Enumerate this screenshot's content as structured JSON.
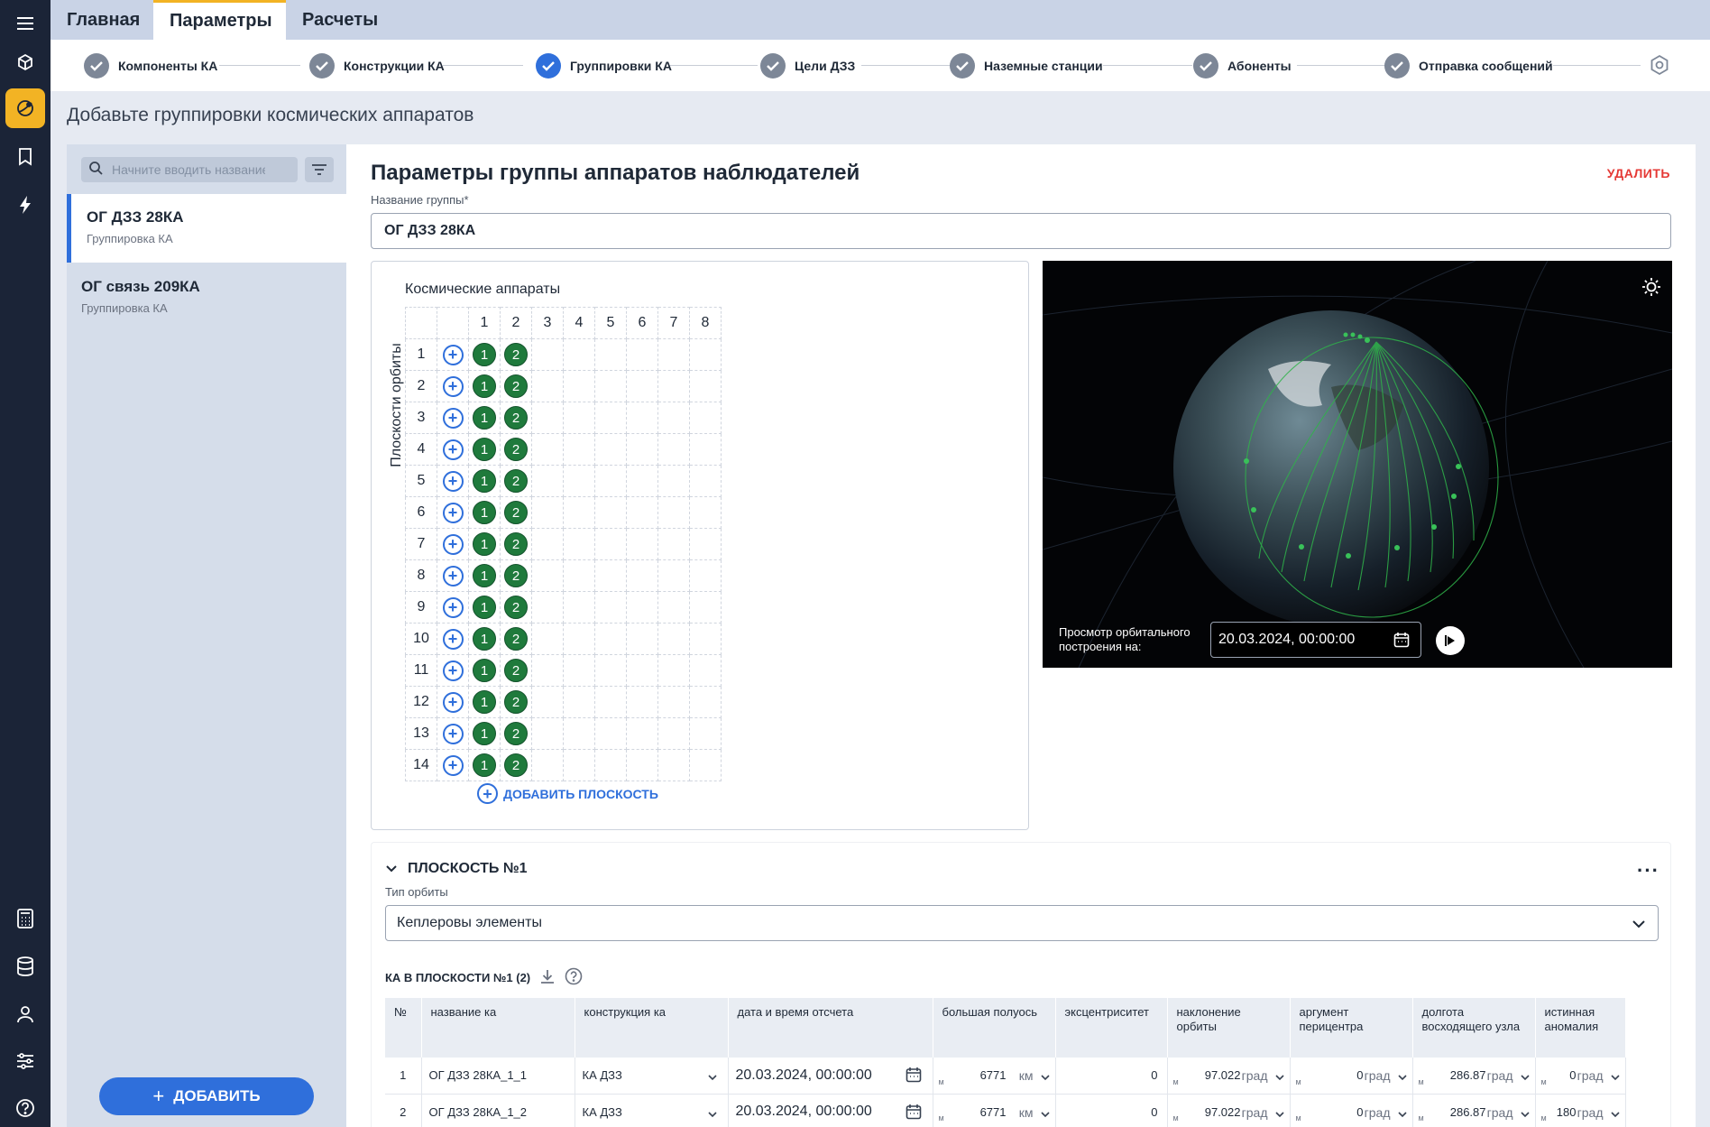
{
  "top_tabs": [
    {
      "label": "Главная"
    },
    {
      "label": "Параметры"
    },
    {
      "label": "Расчеты"
    }
  ],
  "steps": [
    {
      "label": "Компоненты КА"
    },
    {
      "label": "Конструкции КА"
    },
    {
      "label": "Группировки КА"
    },
    {
      "label": "Цели ДЗЗ"
    },
    {
      "label": "Наземные станции"
    },
    {
      "label": "Абоненты"
    },
    {
      "label": "Отправка сообщений"
    }
  ],
  "page_title": "Добавьте группировки космических аппаратов",
  "search": {
    "placeholder": "Начните вводить название"
  },
  "groups": [
    {
      "title": "ОГ ДЗЗ 28КА",
      "subtitle": "Группировка КА"
    },
    {
      "title": "ОГ связь 209КА",
      "subtitle": "Группировка КА"
    }
  ],
  "add_button": "ДОБАВИТЬ",
  "main": {
    "title": "Параметры группы аппаратов наблюдателей",
    "delete_label": "УДАЛИТЬ",
    "group_name_label": "Название группы*",
    "group_name_value": "ОГ ДЗЗ 28КА"
  },
  "grid": {
    "title": "Космические аппараты",
    "vertical_label": "Плоскости орбиты",
    "columns": [
      "1",
      "2",
      "3",
      "4",
      "5",
      "6",
      "7",
      "8"
    ],
    "rows": [
      "1",
      "2",
      "3",
      "4",
      "5",
      "6",
      "7",
      "8",
      "9",
      "10",
      "11",
      "12",
      "13",
      "14"
    ],
    "sat_labels": [
      "1",
      "2"
    ],
    "add_plane": "ДОБАВИТЬ ПЛОСКОСТЬ"
  },
  "globe": {
    "view_label_1": "Просмотр орбитального",
    "view_label_2": "построения на:",
    "date": "20.03.2024, 00:00:00"
  },
  "plane": {
    "title": "ПЛОСКОСТЬ №1",
    "orbit_type_label": "Тип орбиты",
    "orbit_type_value": "Кеплеровы элементы",
    "ka_header": "КА В ПЛОСКОСТИ №1 (2)"
  },
  "table": {
    "headers": [
      "№",
      "название ка",
      "конструкция ка",
      "дата и время отсчета",
      "большая полуось",
      "эксцентриситет",
      "наклонение орбиты",
      "аргумент перицентра",
      "долгота восходящего узла",
      "истинная аномалия"
    ],
    "units": {
      "m": "м",
      "km": "км",
      "deg": "град"
    },
    "rows": [
      {
        "n": "1",
        "name": "ОГ ДЗЗ 28КА_1_1",
        "construction": "КА ДЗЗ",
        "datetime": "20.03.2024, 00:00:00",
        "semi_major": "6771",
        "ecc": "0",
        "incl": "97.022",
        "arg_peri": "0",
        "raan": "286.87",
        "anomaly": "0"
      },
      {
        "n": "2",
        "name": "ОГ ДЗЗ 28КА_1_2",
        "construction": "КА ДЗЗ",
        "datetime": "20.03.2024, 00:00:00",
        "semi_major": "6771",
        "ecc": "0",
        "incl": "97.022",
        "arg_peri": "0",
        "raan": "286.87",
        "anomaly": "180"
      }
    ]
  },
  "colors": {
    "rail": "#1b2437",
    "accent_yellow": "#f2b324",
    "primary_blue": "#2f6fdb",
    "sat_green": "#1f7a3c",
    "danger_red": "#e53935"
  }
}
